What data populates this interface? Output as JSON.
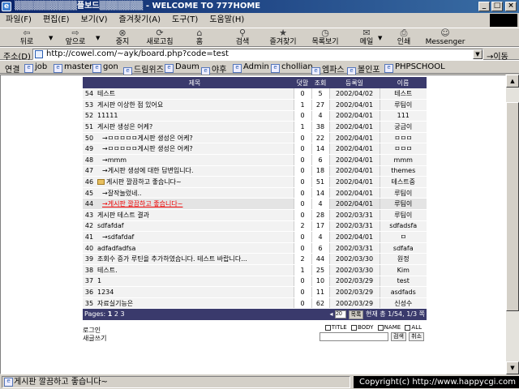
{
  "window": {
    "title": "▒▒▒▒▒▒▒▒▒▒플보드▒▒▒▒▒▒▒ - WELCOME TO 777HOME",
    "controls": [
      "_",
      "□",
      "×"
    ]
  },
  "menu": [
    "파일(F)",
    "편집(E)",
    "보기(V)",
    "즐겨찾기(A)",
    "도구(T)",
    "도움말(H)"
  ],
  "toolbar": {
    "back": "뒤로",
    "forward": "앞으로",
    "stop": "중지",
    "refresh": "새로고침",
    "home": "홈",
    "search": "검색",
    "favorites": "즐겨찾기",
    "history": "목록보기",
    "mail": "메일",
    "print": "인쇄",
    "messenger": "Messenger"
  },
  "address": {
    "label": "주소(D)",
    "url": "http://cowel.com/~ayk/board.php?code=test",
    "go": "이동"
  },
  "links": {
    "label": "연결",
    "items": [
      "job",
      "master",
      "gon",
      "드림위즈",
      "Daum",
      "야후",
      "Admin",
      "chollian",
      "엠파스",
      "볼인포",
      "PHPSCHOOL"
    ]
  },
  "board": {
    "headers": {
      "no": "",
      "subject": "제목",
      "reply": "덧말",
      "hits": "조회",
      "date": "등록일",
      "name": "이름"
    },
    "rows": [
      {
        "no": "54",
        "subject": "테스트",
        "reply": "0",
        "hits": "5",
        "date": "2002/04/02",
        "name": "테스트"
      },
      {
        "no": "53",
        "subject": "게시판 이상한 점 있어요",
        "reply": "1",
        "hits": "27",
        "date": "2002/04/01",
        "name": "루팀이"
      },
      {
        "no": "52",
        "subject": "11111",
        "reply": "0",
        "hits": "4",
        "date": "2002/04/01",
        "name": "111"
      },
      {
        "no": "51",
        "subject": "게시판 생성은 어케?",
        "reply": "1",
        "hits": "38",
        "date": "2002/04/01",
        "name": "궁금이"
      },
      {
        "no": "50",
        "subject": "→ㅁㅁㅁㅁㅁ게시판 생성은 어케?",
        "reply": "0",
        "hits": "22",
        "date": "2002/04/01",
        "name": "ㅁㅁㅁ"
      },
      {
        "no": "49",
        "subject": "→ㅁㅁㅁㅁㅁ게시판 생성은 어케?",
        "reply": "0",
        "hits": "14",
        "date": "2002/04/01",
        "name": "ㅁㅁㅁ"
      },
      {
        "no": "48",
        "subject": "→mmm",
        "reply": "0",
        "hits": "6",
        "date": "2002/04/01",
        "name": "mmm"
      },
      {
        "no": "47",
        "subject": "→게시판 생성에 대한 답변입니다.",
        "reply": "0",
        "hits": "18",
        "date": "2002/04/01",
        "name": "themes"
      },
      {
        "no": "46",
        "subject": "게시판 깔끔하고 좋습니다~",
        "reply": "0",
        "hits": "51",
        "date": "2002/04/01",
        "name": "테스트중"
      },
      {
        "no": "45",
        "subject": "→잘작눌렀네..",
        "reply": "0",
        "hits": "14",
        "date": "2002/04/01",
        "name": "루팀이"
      },
      {
        "no": "44",
        "subject": "→게시판 깔끔하고 좋습니다~",
        "reply": "0",
        "hits": "4",
        "date": "2002/04/01",
        "name": "루팀이"
      },
      {
        "no": "43",
        "subject": "게시판 테스트 결과",
        "reply": "0",
        "hits": "28",
        "date": "2002/03/31",
        "name": "루팀이"
      },
      {
        "no": "42",
        "subject": "sdfafdaf",
        "reply": "2",
        "hits": "17",
        "date": "2002/03/31",
        "name": "sdfadsfa"
      },
      {
        "no": "41",
        "subject": "→sdfafdaf",
        "reply": "0",
        "hits": "4",
        "date": "2002/04/01",
        "name": "ㅁ"
      },
      {
        "no": "40",
        "subject": "adfadfadfsa",
        "reply": "0",
        "hits": "6",
        "date": "2002/03/31",
        "name": "sdfafa"
      },
      {
        "no": "39",
        "subject": "조회수 증가 루틴을 추가하였습니다. 테스트 바랍니다...",
        "reply": "2",
        "hits": "44",
        "date": "2002/03/30",
        "name": "원정"
      },
      {
        "no": "38",
        "subject": "테스트.",
        "reply": "1",
        "hits": "25",
        "date": "2002/03/30",
        "name": "Kim"
      },
      {
        "no": "37",
        "subject": "1",
        "reply": "0",
        "hits": "10",
        "date": "2002/03/29",
        "name": "test"
      },
      {
        "no": "36",
        "subject": "1234",
        "reply": "0",
        "hits": "11",
        "date": "2002/03/29",
        "name": "asdfads"
      },
      {
        "no": "35",
        "subject": "자료실기능은",
        "reply": "0",
        "hits": "62",
        "date": "2002/03/29",
        "name": "신성수"
      }
    ],
    "current_row_no": "44",
    "pages_label": "Pages:",
    "pages": [
      "1",
      "2",
      "3"
    ],
    "current_page": "1",
    "per_page_value": "20",
    "per_page_button": "목록",
    "summary": "현재 총 1/54, 1/3 쪽",
    "bottom_links": [
      "로그인",
      "새글쓰기"
    ],
    "search_options": [
      "TITLE",
      "BODY",
      "NAME",
      "ALL"
    ],
    "search_buttons": [
      "검색",
      "취소"
    ]
  },
  "status": {
    "message": "게시판 깔끔하고 좋습니다~",
    "copyright": "Copyright(c) http://www.happycgi.com"
  }
}
